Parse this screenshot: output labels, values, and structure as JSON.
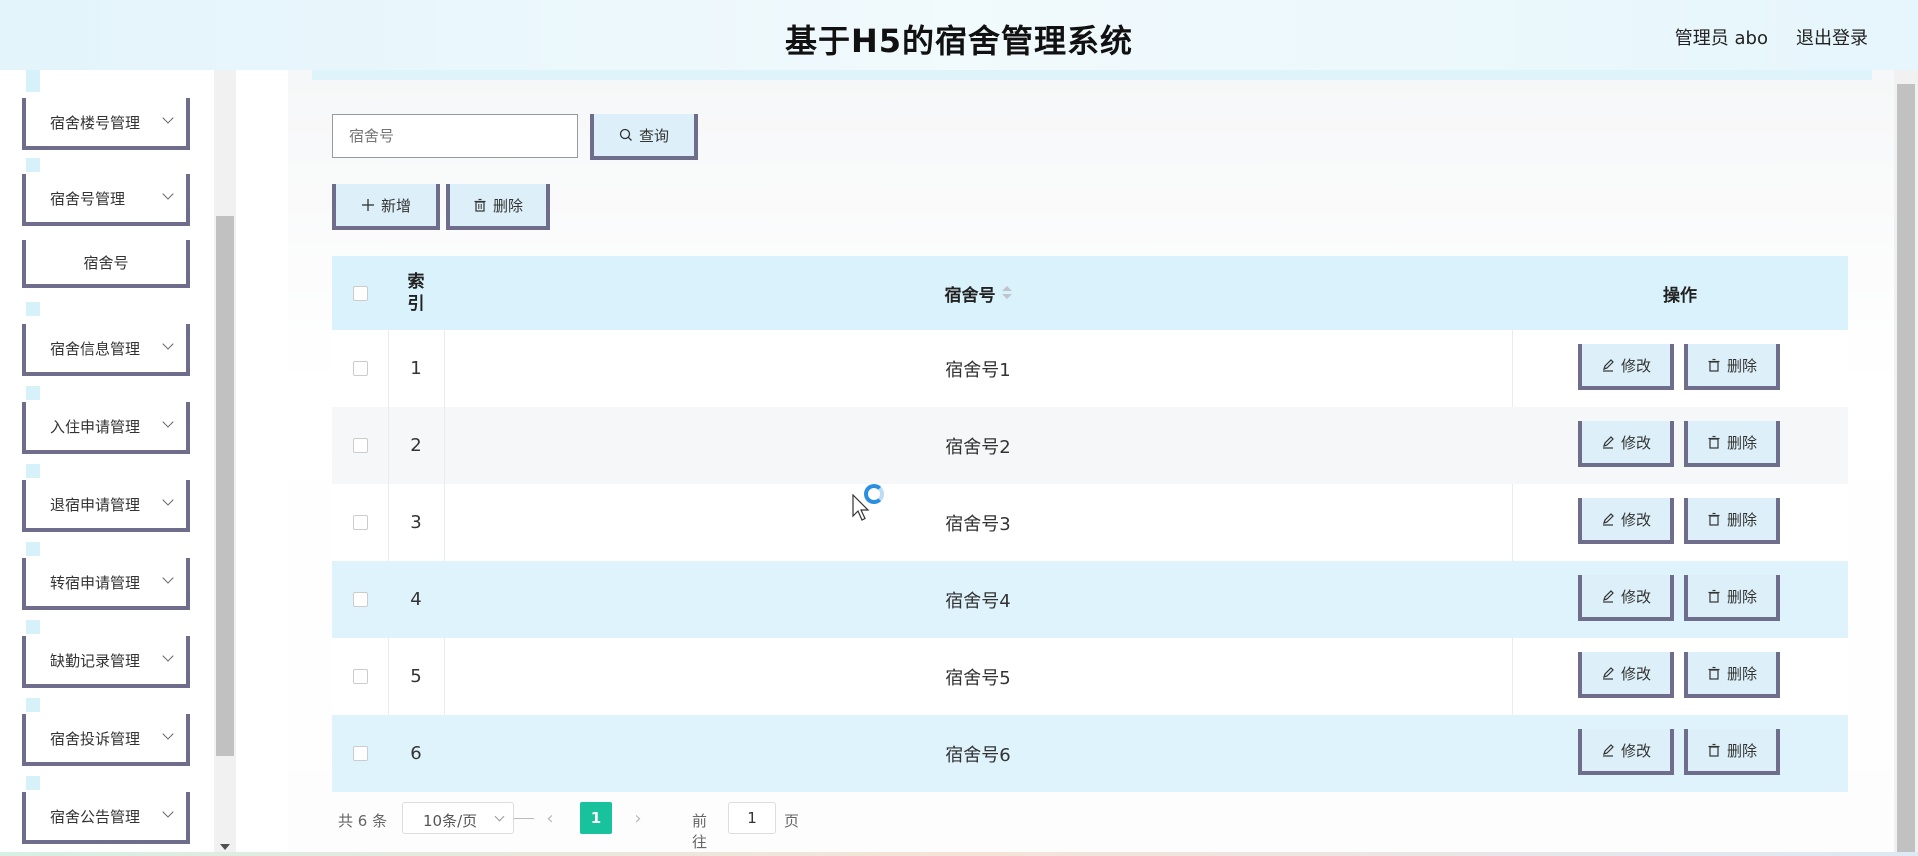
{
  "header": {
    "title": "基于H5的宿舍管理系统",
    "user": "管理员 abo",
    "logout": "退出登录"
  },
  "sidebar": {
    "items": [
      {
        "label": "宿舍楼号管理",
        "icon": "chevron-down-icon"
      },
      {
        "label": "宿舍号管理",
        "icon": "chevron-down-icon"
      },
      {
        "label": "宿舍号",
        "sub": true
      },
      {
        "label": "宿舍信息管理",
        "icon": "chevron-down-icon"
      },
      {
        "label": "入住申请管理",
        "icon": "chevron-down-icon"
      },
      {
        "label": "退宿申请管理",
        "icon": "chevron-down-icon"
      },
      {
        "label": "转宿申请管理",
        "icon": "chevron-down-icon"
      },
      {
        "label": "缺勤记录管理",
        "icon": "chevron-down-icon"
      },
      {
        "label": "宿舍投诉管理",
        "icon": "chevron-down-icon"
      },
      {
        "label": "宿舍公告管理",
        "icon": "chevron-down-icon"
      }
    ]
  },
  "search": {
    "placeholder": "宿舍号",
    "value": "",
    "query_label": "查询"
  },
  "toolbar": {
    "add_label": "新增",
    "delete_label": "删除"
  },
  "table": {
    "headers": {
      "index": "索引",
      "dorm": "宿舍号",
      "ops": "操作"
    },
    "rows": [
      {
        "index": "1",
        "dorm": "宿舍号1"
      },
      {
        "index": "2",
        "dorm": "宿舍号2"
      },
      {
        "index": "3",
        "dorm": "宿舍号3"
      },
      {
        "index": "4",
        "dorm": "宿舍号4"
      },
      {
        "index": "5",
        "dorm": "宿舍号5"
      },
      {
        "index": "6",
        "dorm": "宿舍号6"
      }
    ],
    "edit_label": "修改",
    "remove_label": "删除"
  },
  "pager": {
    "total": "共 6 条",
    "page_size": "10条/页",
    "current_page": "1",
    "goto_prefix": "前往",
    "goto_value": "1",
    "goto_suffix": "页"
  },
  "colors": {
    "accent_green": "#18c29c",
    "button_bg": "#ddf0f9",
    "button_border": "#6f6d8c",
    "header_bg": "#e3f4fb"
  }
}
